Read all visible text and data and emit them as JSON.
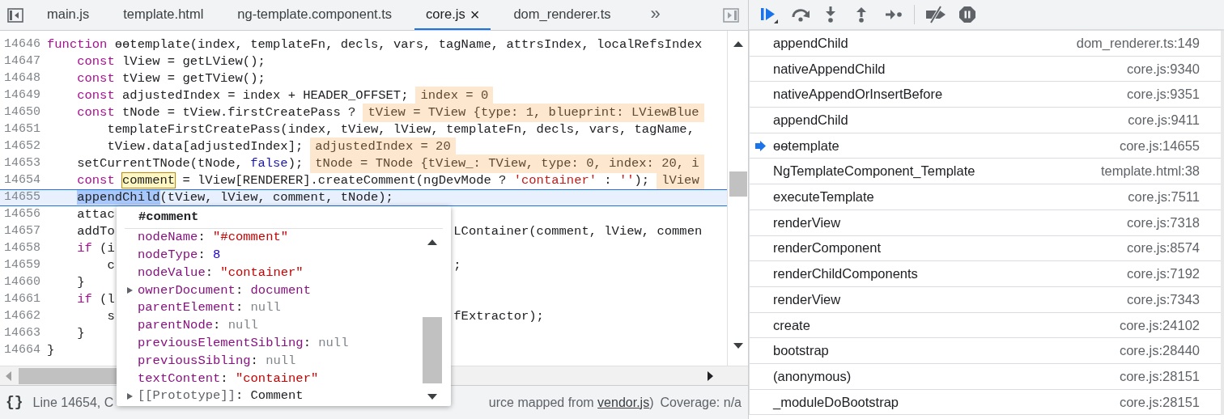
{
  "editor": {
    "tabs": [
      {
        "label": "main.js",
        "selected": false
      },
      {
        "label": "template.html",
        "selected": false
      },
      {
        "label": "ng-template.component.ts",
        "selected": false
      },
      {
        "label": "core.js",
        "selected": true,
        "close": "×"
      },
      {
        "label": "dom_renderer.ts",
        "selected": false
      }
    ],
    "more_tabs": "»",
    "lines": [
      {
        "number": "14646",
        "current": false,
        "tokens": [
          {
            "kind": "keyword",
            "text": "function"
          },
          {
            "kind": "plain",
            "text": " ɵɵtemplate(index, templateFn, decls, vars, tagName, attrsIndex, localRefsIndex"
          }
        ]
      },
      {
        "number": "14647",
        "current": false,
        "tokens": [
          {
            "kind": "keyword",
            "text": "    const"
          },
          {
            "kind": "plain",
            "text": " lView = getLView();"
          }
        ]
      },
      {
        "number": "14648",
        "current": false,
        "tokens": [
          {
            "kind": "keyword",
            "text": "    const"
          },
          {
            "kind": "plain",
            "text": " tView = getTView();"
          }
        ]
      },
      {
        "number": "14649",
        "current": false,
        "tokens": [
          {
            "kind": "keyword",
            "text": "    const"
          },
          {
            "kind": "plain",
            "text": " adjustedIndex = index + HEADER_OFFSET;"
          }
        ],
        "inline_value": "index = 0"
      },
      {
        "number": "14650",
        "current": false,
        "tokens": [
          {
            "kind": "keyword",
            "text": "    const"
          },
          {
            "kind": "plain",
            "text": " tNode = tView.firstCreatePass ?"
          }
        ],
        "inline_value": "tView = TView {type: 1, blueprint: LViewBlue"
      },
      {
        "number": "14651",
        "current": false,
        "tokens": [
          {
            "kind": "plain",
            "text": "        templateFirstCreatePass(index, tView, lView, templateFn, decls, vars, tagName,"
          }
        ]
      },
      {
        "number": "14652",
        "current": false,
        "tokens": [
          {
            "kind": "plain",
            "text": "        tView.data[adjustedIndex];"
          }
        ],
        "inline_value": "adjustedIndex = 20"
      },
      {
        "number": "14653",
        "current": false,
        "tokens": [
          {
            "kind": "plain",
            "text": "    setCurrentTNode(tNode, "
          },
          {
            "kind": "literal",
            "text": "false"
          },
          {
            "kind": "plain",
            "text": ");"
          }
        ],
        "inline_value": "tNode = TNode {tView_: TView, type: 0, index: 20, i"
      },
      {
        "number": "14654",
        "current": false,
        "tokens": [
          {
            "kind": "keyword",
            "text": "    const "
          },
          {
            "kind": "hovered",
            "text": "comment"
          },
          {
            "kind": "plain",
            "text": " = lView[RENDERER].createComment(ngDevMode ? "
          },
          {
            "kind": "string",
            "text": "'container'"
          },
          {
            "kind": "plain",
            "text": " : "
          },
          {
            "kind": "string",
            "text": "''"
          },
          {
            "kind": "plain",
            "text": ");"
          }
        ],
        "inline_value": "lView"
      },
      {
        "number": "14655",
        "current": true,
        "tokens": [
          {
            "kind": "selected",
            "text": "    appendChild"
          },
          {
            "kind": "plain",
            "text": "(tView, lView, comment, tNode);"
          }
        ]
      },
      {
        "number": "14656",
        "current": false,
        "tokens": [
          {
            "kind": "plain",
            "text": "    attac"
          }
        ]
      },
      {
        "number": "14657",
        "current": false,
        "tokens": [
          {
            "kind": "plain",
            "text": "    addTo"
          }
        ],
        "tokens_right": [
          {
            "kind": "plain",
            "text": "LContainer(comment, lView, commen"
          }
        ]
      },
      {
        "number": "14658",
        "current": false,
        "tokens": [
          {
            "kind": "keyword",
            "text": "    if"
          },
          {
            "kind": "plain",
            "text": " (i"
          }
        ]
      },
      {
        "number": "14659",
        "current": false,
        "tokens": [
          {
            "kind": "plain",
            "text": "        c"
          }
        ],
        "tokens_right": [
          {
            "kind": "plain",
            "text": ";"
          }
        ]
      },
      {
        "number": "14660",
        "current": false,
        "tokens": [
          {
            "kind": "plain",
            "text": "    }"
          }
        ]
      },
      {
        "number": "14661",
        "current": false,
        "tokens": [
          {
            "kind": "keyword",
            "text": "    if"
          },
          {
            "kind": "plain",
            "text": " (l"
          }
        ]
      },
      {
        "number": "14662",
        "current": false,
        "tokens": [
          {
            "kind": "plain",
            "text": "        s"
          }
        ],
        "tokens_right": [
          {
            "kind": "plain",
            "text": "fExtractor);"
          }
        ]
      },
      {
        "number": "14663",
        "current": false,
        "tokens": [
          {
            "kind": "plain",
            "text": "    }"
          }
        ]
      },
      {
        "number": "14664",
        "current": false,
        "tokens": [
          {
            "kind": "plain",
            "text": "}"
          }
        ]
      }
    ],
    "popup": {
      "title": "#comment",
      "properties": [
        {
          "name": "nodeName",
          "kind": "own",
          "separator": ":",
          "value": {
            "kind": "string",
            "text": "\"#comment\""
          },
          "expandable": false
        },
        {
          "name": "nodeType",
          "kind": "own",
          "separator": ":",
          "value": {
            "kind": "number",
            "text": "8"
          },
          "expandable": false
        },
        {
          "name": "nodeValue",
          "kind": "own",
          "separator": ":",
          "value": {
            "kind": "string",
            "text": "\"container\""
          },
          "expandable": false
        },
        {
          "name": "ownerDocument",
          "kind": "own",
          "separator": ":",
          "value": {
            "kind": "object",
            "text": "document"
          },
          "expandable": true
        },
        {
          "name": "parentElement",
          "kind": "own",
          "separator": ":",
          "value": {
            "kind": "null",
            "text": "null"
          },
          "expandable": false
        },
        {
          "name": "parentNode",
          "kind": "own",
          "separator": ":",
          "value": {
            "kind": "null",
            "text": "null"
          },
          "expandable": false
        },
        {
          "name": "previousElementSibling",
          "kind": "own",
          "separator": ":",
          "value": {
            "kind": "null",
            "text": "null"
          },
          "expandable": false
        },
        {
          "name": "previousSibling",
          "kind": "own",
          "separator": ":",
          "value": {
            "kind": "null",
            "text": "null"
          },
          "expandable": false
        },
        {
          "name": "textContent",
          "kind": "own",
          "separator": ":",
          "value": {
            "kind": "string",
            "text": "\"container\""
          },
          "expandable": false
        },
        {
          "name": "[[Prototype]]",
          "kind": "internal",
          "separator": ":",
          "value": {
            "kind": "class",
            "text": "Comment"
          },
          "expandable": true
        }
      ]
    },
    "status_bar": {
      "format_button": "{}",
      "position": "Line 14654, C",
      "source_before": "urce mapped from ",
      "source_link": "vendor.js",
      "source_after": ")",
      "coverage": "Coverage: n/a"
    }
  },
  "debugger": {
    "call_stack": [
      {
        "name": "appendChild",
        "location": "dom_renderer.ts:149",
        "selected": false
      },
      {
        "name": "nativeAppendChild",
        "location": "core.js:9340",
        "selected": false
      },
      {
        "name": "nativeAppendOrInsertBefore",
        "location": "core.js:9351",
        "selected": false
      },
      {
        "name": "appendChild",
        "location": "core.js:9411",
        "selected": false
      },
      {
        "name": "ɵɵtemplate",
        "location": "core.js:14655",
        "selected": true
      },
      {
        "name": "NgTemplateComponent_Template",
        "location": "template.html:38",
        "selected": false
      },
      {
        "name": "executeTemplate",
        "location": "core.js:7511",
        "selected": false
      },
      {
        "name": "renderView",
        "location": "core.js:7318",
        "selected": false
      },
      {
        "name": "renderComponent",
        "location": "core.js:8574",
        "selected": false
      },
      {
        "name": "renderChildComponents",
        "location": "core.js:7192",
        "selected": false
      },
      {
        "name": "renderView",
        "location": "core.js:7343",
        "selected": false
      },
      {
        "name": "create",
        "location": "core.js:24102",
        "selected": false
      },
      {
        "name": "bootstrap",
        "location": "core.js:28440",
        "selected": false
      },
      {
        "name": "(anonymous)",
        "location": "core.js:28151",
        "selected": false
      },
      {
        "name": "_moduleDoBootstrap",
        "location": "core.js:28151",
        "selected": false
      }
    ]
  }
}
